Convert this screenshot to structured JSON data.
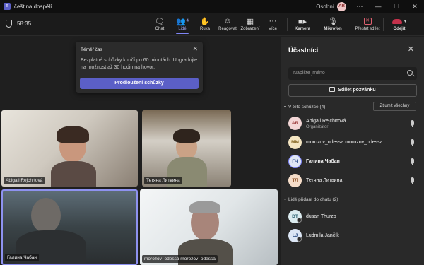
{
  "titlebar": {
    "app_title": "čeština dospělí",
    "profile": "Osobní",
    "avatar_initials": "AR",
    "minimize": "—",
    "maximize": "☐",
    "close": "✕"
  },
  "toolbar": {
    "timer": "58:35",
    "buttons": [
      {
        "label": "Chat"
      },
      {
        "label": "Lidé",
        "count": "4"
      },
      {
        "label": "Ruka"
      },
      {
        "label": "Reagovat"
      },
      {
        "label": "Zobrazení"
      },
      {
        "label": "Více"
      },
      {
        "label": "Kamera"
      },
      {
        "label": "Mikrofon"
      },
      {
        "label": "Přestat sdílet"
      },
      {
        "label": "Odejít"
      }
    ],
    "accent_color": "#5b5fc7",
    "leave_color": "#c4314b"
  },
  "popup": {
    "title": "Téměř čas",
    "text": "Bezplatné schůzky končí po 60 minutách. Upgradujte na možnost až 30 hodin na hovor.",
    "button": "Prodloužení schůzky"
  },
  "video_tiles": [
    {
      "name": "Abigail Rejchrtová"
    },
    {
      "name": "Тетяна Литвина"
    },
    {
      "name": "Галина Чабан"
    },
    {
      "name": "morozov_odessa morozov_odessa"
    }
  ],
  "panel": {
    "title": "Účastníci",
    "search_placeholder": "Napište jméno",
    "share_invite": "Sdílet pozvánku",
    "in_meeting_section": "V této schůzce (4)",
    "mute_all": "Ztlumit všechny",
    "participants": [
      {
        "initials": "AR",
        "name": "Abigail Rejchrtová",
        "role": "Organizátor",
        "avatar_bg": "#f3d6d6",
        "avatar_fg": "#9c3b3b"
      },
      {
        "initials": "MM",
        "name": "morozov_odessa morozov_odessa",
        "avatar_bg": "#f5e6c2",
        "avatar_fg": "#7a5a14"
      },
      {
        "initials": "ГЧ",
        "name": "Галина Чабан",
        "avatar_bg": "#dfe6f5",
        "avatar_fg": "#2a4a8a"
      },
      {
        "initials": "ТЛ",
        "name": "Тетяна Литвина",
        "avatar_bg": "#f5dcc8",
        "avatar_fg": "#8a4a1c"
      }
    ],
    "chat_section": "Lidé přidaní do chatu (2)",
    "chat_people": [
      {
        "initials": "DT",
        "name": "dusan Thurzo",
        "avatar_bg": "#dcecf0",
        "avatar_fg": "#2a6070"
      },
      {
        "initials": "LJ",
        "name": "Ludmila Jančík",
        "avatar_bg": "#dce6f5",
        "avatar_fg": "#2a4a80"
      }
    ]
  }
}
